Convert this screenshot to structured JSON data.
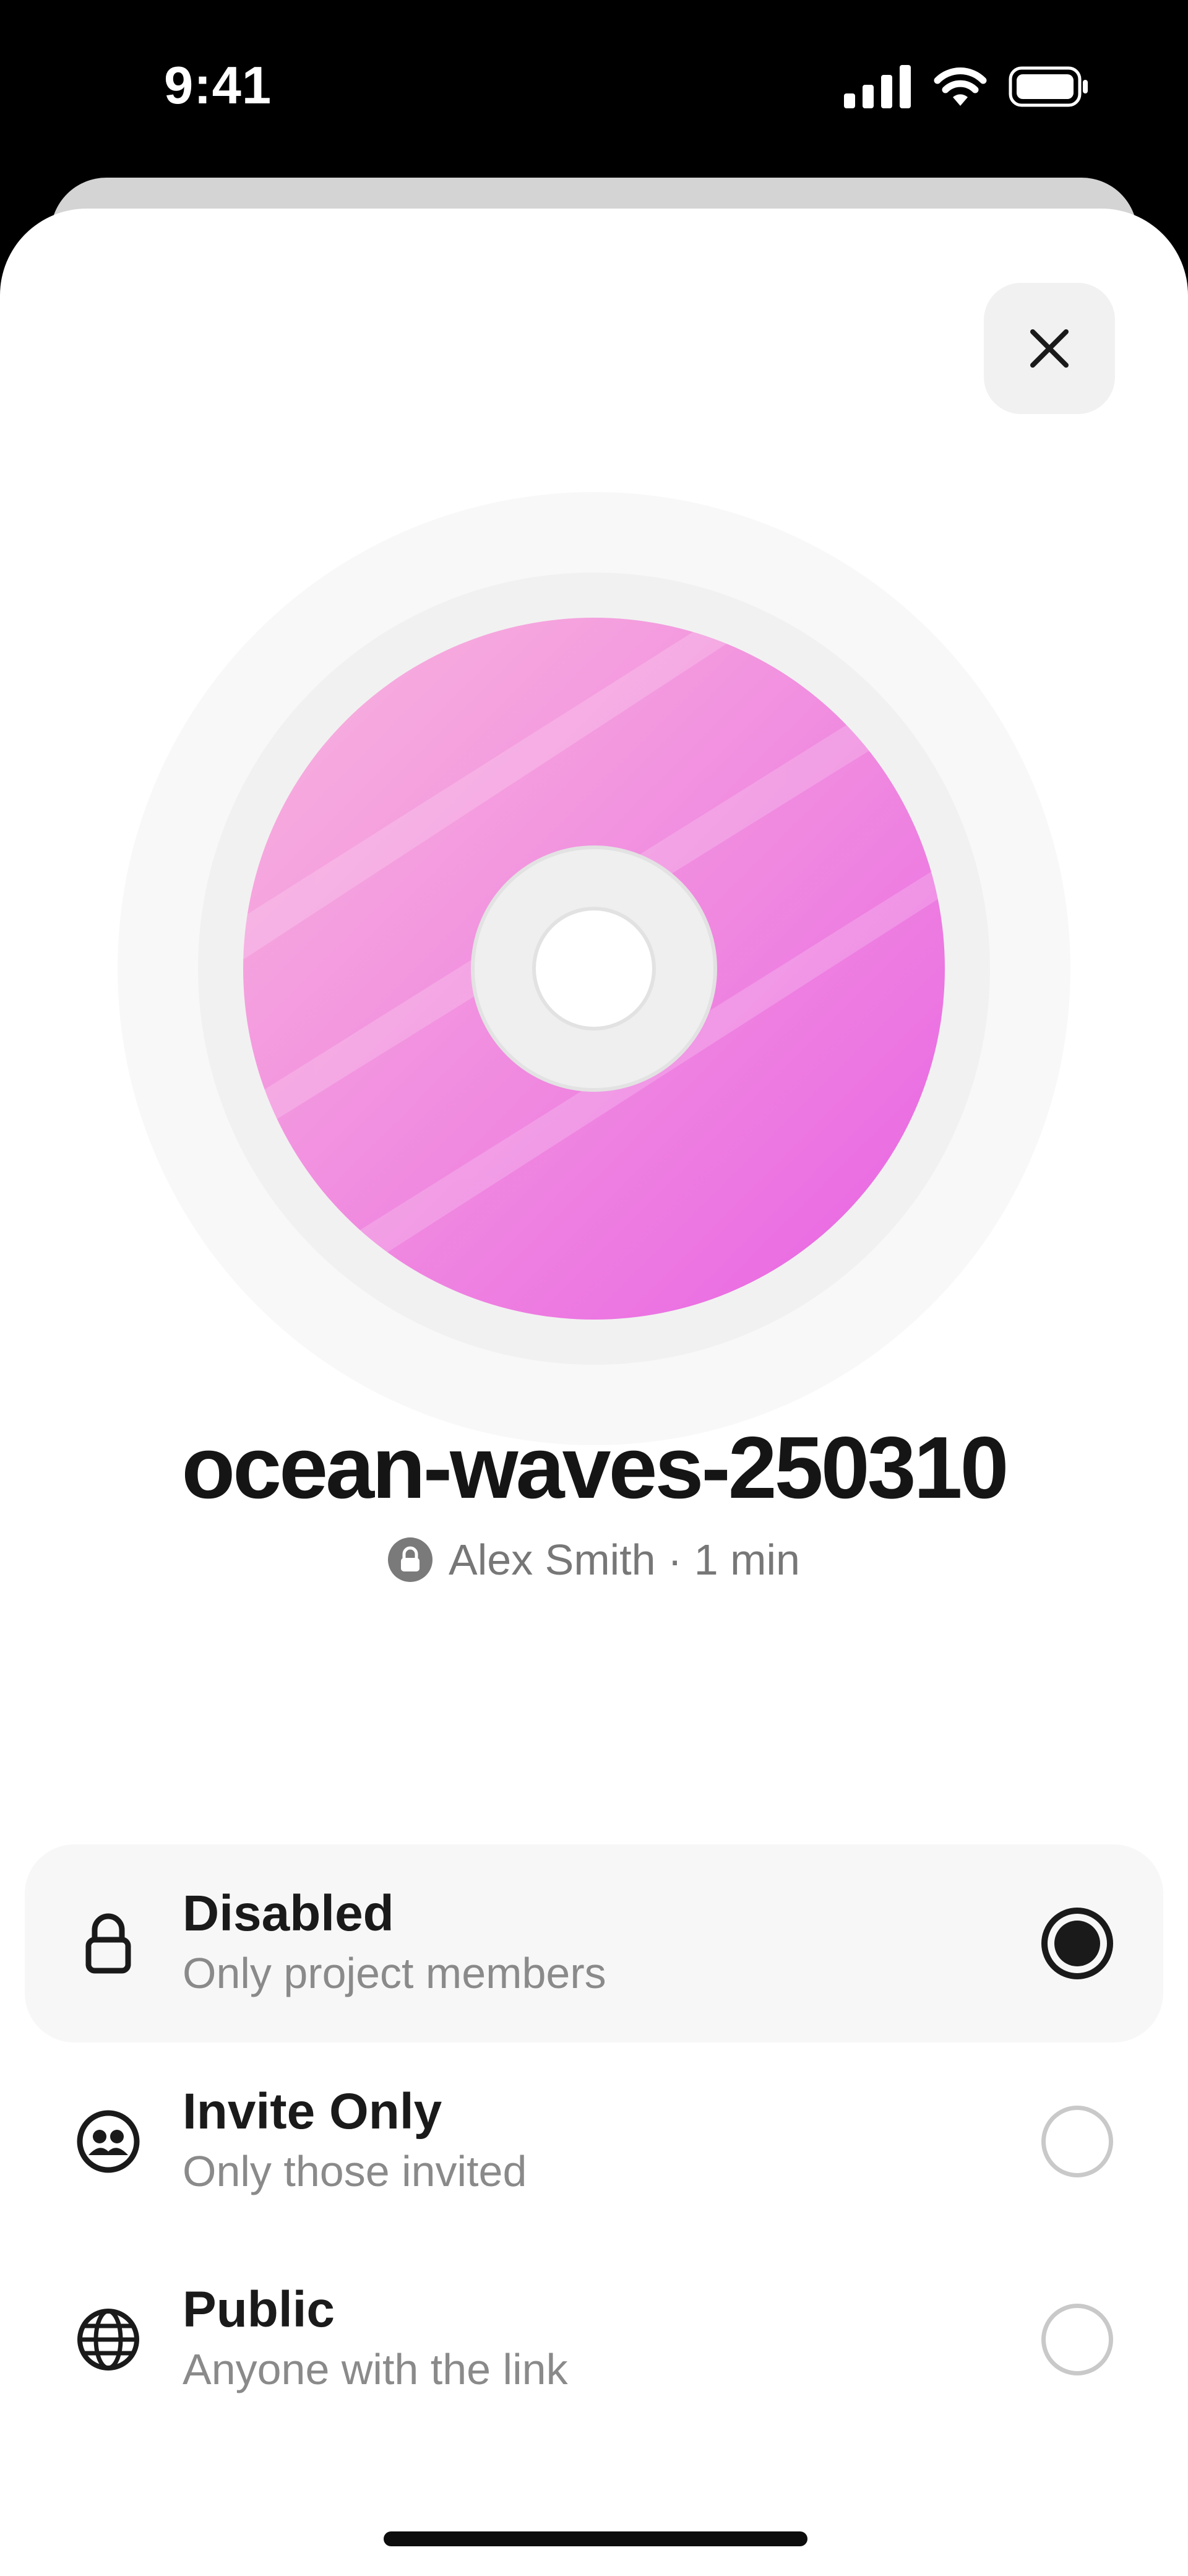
{
  "status_bar": {
    "time": "9:41"
  },
  "file": {
    "name": "ocean-waves-250310",
    "owner": "Alex Smith",
    "separator": " · ",
    "duration": "1 min"
  },
  "icons": {
    "close": "close-icon",
    "lock": "lock-icon",
    "group": "group-icon",
    "globe": "globe-icon",
    "disc": "disc-icon"
  },
  "colors": {
    "disc_top": "#f7a9dc",
    "disc_bottom": "#e96be3",
    "selected_bg": "#f7f7f7",
    "text_primary": "#1a1a1a",
    "text_secondary": "#8a8a8a"
  },
  "sharing_options": [
    {
      "title": "Disabled",
      "subtitle": "Only project members",
      "selected": true
    },
    {
      "title": "Invite Only",
      "subtitle": "Only those invited",
      "selected": false
    },
    {
      "title": "Public",
      "subtitle": "Anyone with the link",
      "selected": false
    }
  ]
}
